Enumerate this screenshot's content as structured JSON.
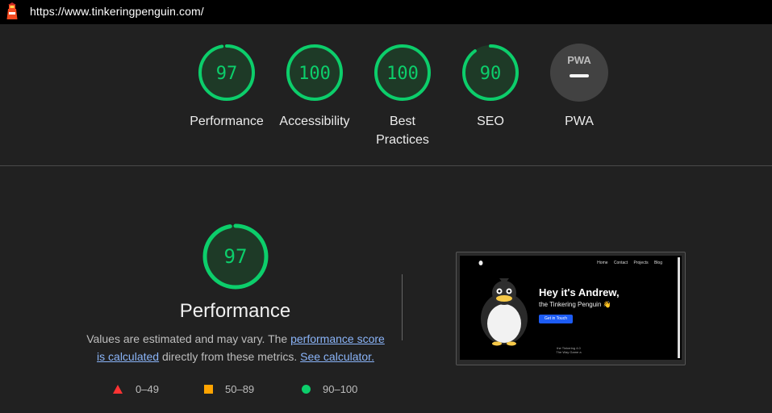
{
  "url": "https://www.tinkeringpenguin.com/",
  "colors": {
    "pass": "#0cce6b",
    "average": "#ffa400",
    "fail": "#ff3333",
    "link": "#8ab4f8"
  },
  "gauges": [
    {
      "score": 97,
      "display": "97",
      "label": "Performance"
    },
    {
      "score": 100,
      "display": "100",
      "label": "Accessibility"
    },
    {
      "score": 100,
      "display": "100",
      "label": "Best Practices"
    },
    {
      "score": 90,
      "display": "90",
      "label": "SEO"
    },
    {
      "score": null,
      "display": "—",
      "badge": "PWA",
      "label": "PWA"
    }
  ],
  "perf": {
    "score": 97,
    "display": "97",
    "title": "Performance",
    "desc_prefix": "Values are estimated and may vary. The ",
    "link1": "performance score is calculated",
    "desc_middle": " directly from these metrics. ",
    "link2": "See calculator."
  },
  "legend": [
    {
      "shape": "triangle",
      "range": "0–49"
    },
    {
      "shape": "square",
      "range": "50–89"
    },
    {
      "shape": "circle",
      "range": "90–100"
    }
  ],
  "screenshot": {
    "nav": [
      "Home",
      "Contact",
      "Projects",
      "Blog"
    ],
    "headline": "Hey it's Andrew,",
    "subline": "the Tinkering Penguin 👋",
    "button": "Get in Touch",
    "footer1": "the Tinkering 4.0",
    "footer2": "The Way Game a"
  }
}
